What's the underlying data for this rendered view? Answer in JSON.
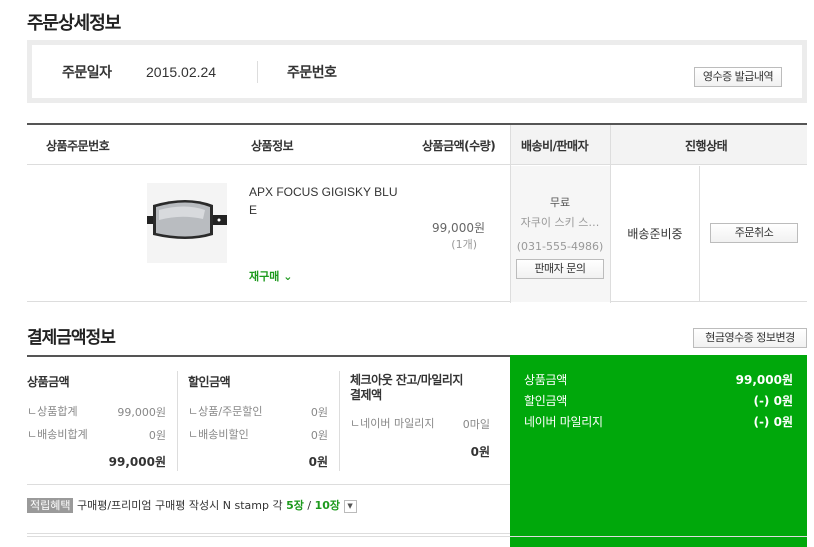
{
  "page_title": "주문상세정보",
  "order": {
    "date_label": "주문일자",
    "date_value": "2015.02.24",
    "number_label": "주문번호",
    "receipt_button": "영수증 발급내역"
  },
  "product_table": {
    "headers": [
      "상품주문번호",
      "상품정보",
      "상품금액(수량)",
      "배송비/판매자",
      "진행상태"
    ],
    "item": {
      "name": "APX FOCUS GIGISKY BLUE",
      "rebuy_label": "재구매",
      "price": "99,000원",
      "qty": "(1개)",
      "shipping": "무료",
      "seller": "자쿠이 스키 스…",
      "phone": "(031-555-4986)",
      "seller_inquiry_button": "판매자 문의",
      "status": "배송준비중",
      "cancel_button": "주문취소"
    }
  },
  "payment": {
    "title": "결제금액정보",
    "cash_receipt_button": "현금영수증 정보변경",
    "product_amount": {
      "header": "상품금액",
      "rows": [
        {
          "label": "ㄴ상품합계",
          "value": "99,000원"
        },
        {
          "label": "ㄴ배송비합계",
          "value": "0원"
        }
      ],
      "total": "99,000원"
    },
    "discount_amount": {
      "header": "할인금액",
      "rows": [
        {
          "label": "ㄴ상품/주문할인",
          "value": "0원"
        },
        {
          "label": "ㄴ배송비할인",
          "value": "0원"
        }
      ],
      "total": "0원"
    },
    "checkout_amount": {
      "header_line1": "체크아웃 잔고/마일리지",
      "header_line2": "결제액",
      "rows": [
        {
          "label": "ㄴ네이버 마일리지",
          "value": "0마일"
        }
      ],
      "total": "0원"
    },
    "summary": [
      {
        "label": "상품금액",
        "value": "99,000원"
      },
      {
        "label": "할인금액",
        "value": "(-) 0원"
      },
      {
        "label": "네이버 마일리지",
        "value": "(-) 0원"
      }
    ],
    "benefit": {
      "tag": "적립혜택",
      "text": "구매평/프리미엄 구매평 작성시 N stamp 각",
      "num1": "5장",
      "slash": "/",
      "num2": "10장"
    }
  },
  "colors": {
    "accent_green": "#00a80b",
    "rebuy_green": "#1d9a1d"
  }
}
